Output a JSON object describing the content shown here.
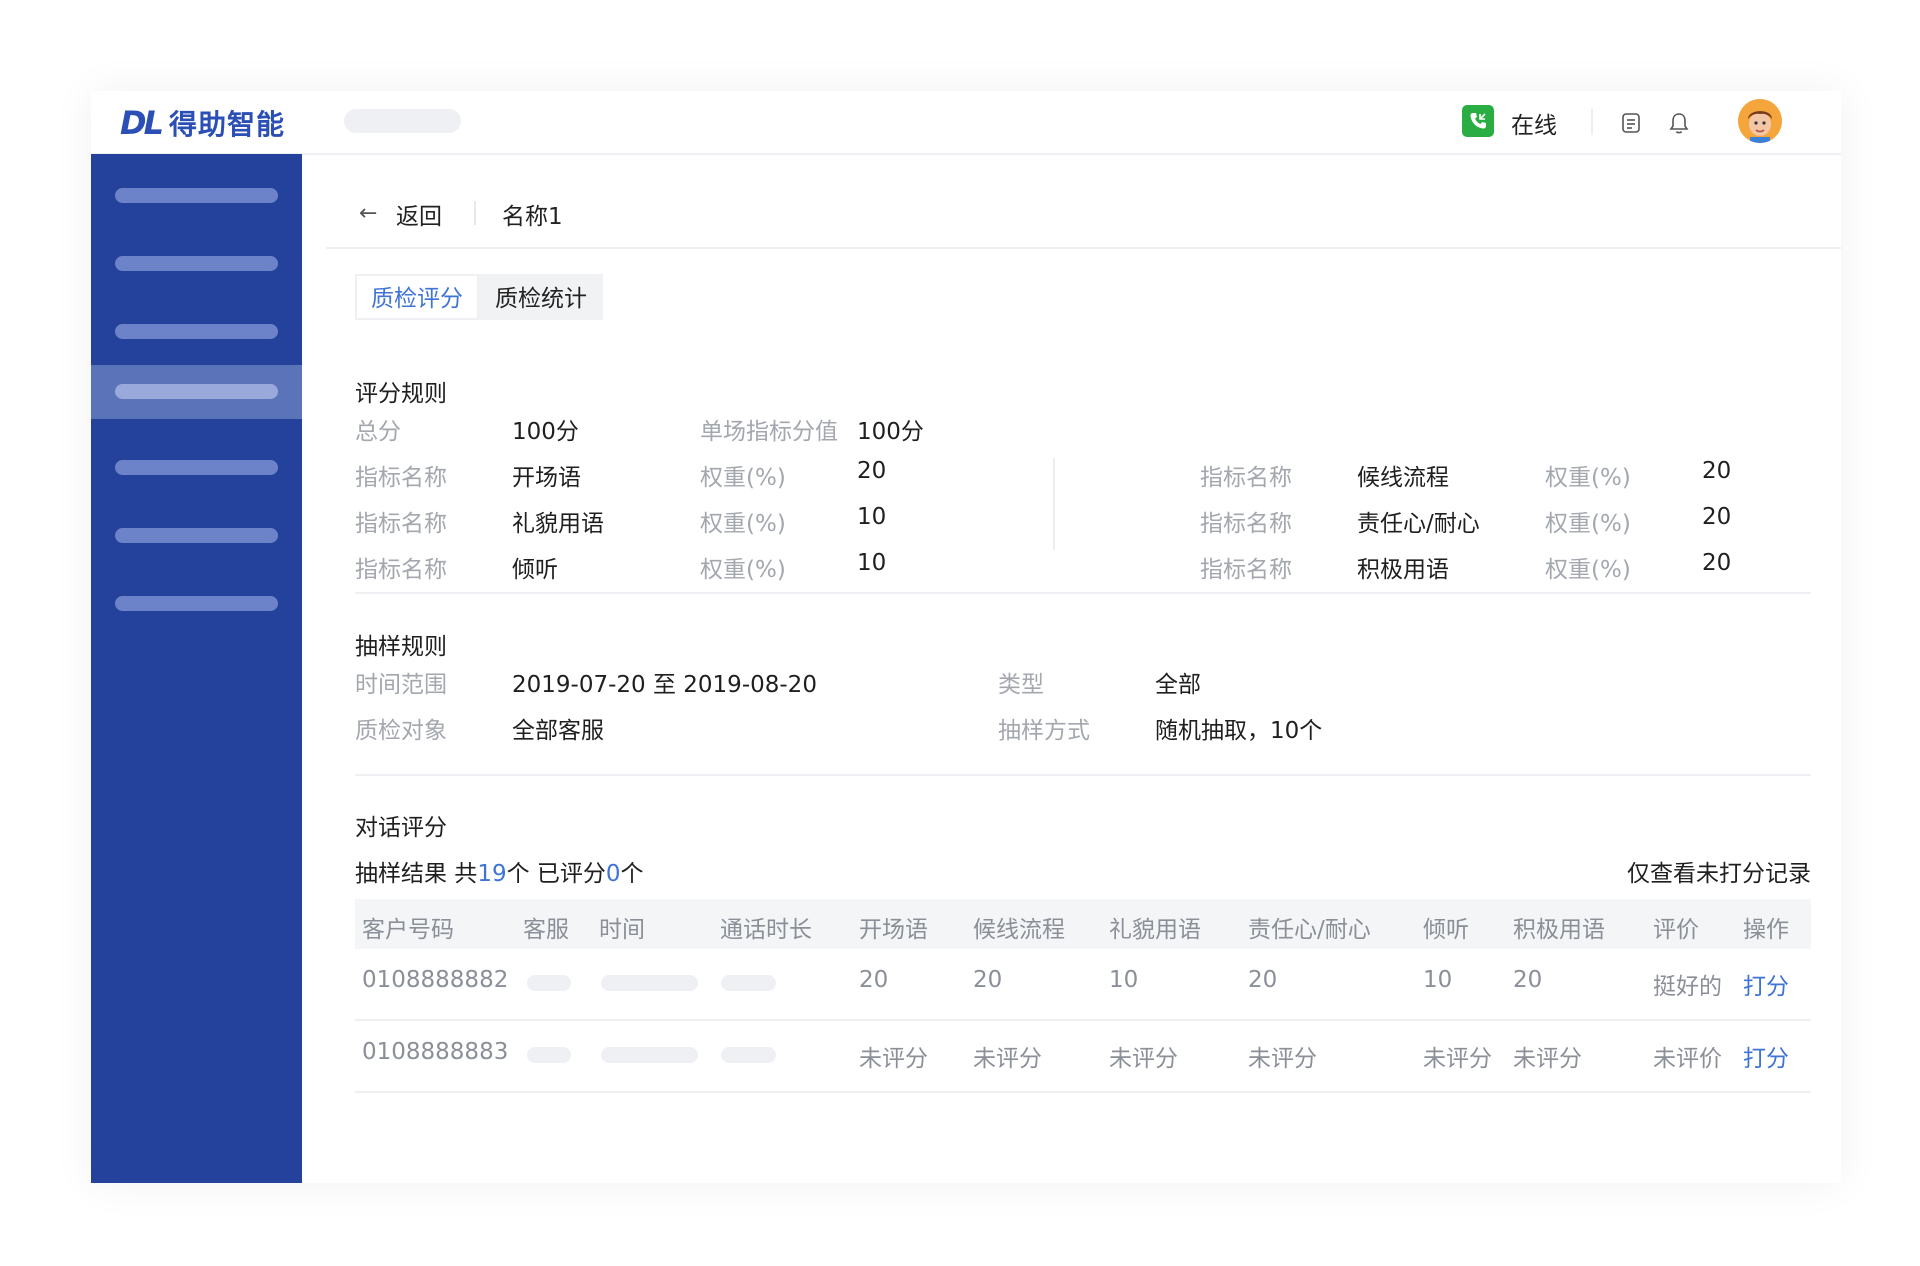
{
  "brand": {
    "mark": "DL",
    "name": "得助智能"
  },
  "header": {
    "status": "在线"
  },
  "breadcrumb": {
    "back": "返回",
    "title": "名称1",
    "back_arrow": "←"
  },
  "tabs": [
    {
      "label": "质检评分",
      "active": true
    },
    {
      "label": "质检统计",
      "active": false
    }
  ],
  "scoring": {
    "title": "评分规则",
    "total_label": "总分",
    "total_value": "100分",
    "single_label": "单场指标分值",
    "single_value": "100分",
    "left_rows": [
      {
        "name_label": "指标名称",
        "name": "开场语",
        "weight_label": "权重(%)",
        "weight": "20"
      },
      {
        "name_label": "指标名称",
        "name": "礼貌用语",
        "weight_label": "权重(%)",
        "weight": "10"
      },
      {
        "name_label": "指标名称",
        "name": "倾听",
        "weight_label": "权重(%)",
        "weight": "10"
      }
    ],
    "right_rows": [
      {
        "name_label": "指标名称",
        "name": "候线流程",
        "weight_label": "权重(%)",
        "weight": "20"
      },
      {
        "name_label": "指标名称",
        "name": "责任心/耐心",
        "weight_label": "权重(%)",
        "weight": "20"
      },
      {
        "name_label": "指标名称",
        "name": "积极用语",
        "weight_label": "权重(%)",
        "weight": "20"
      }
    ]
  },
  "sampling": {
    "title": "抽样规则",
    "range_label": "时间范围",
    "range_value": "2019-07-20 至 2019-08-20",
    "type_label": "类型",
    "type_value": "全部",
    "target_label": "质检对象",
    "target_value": "全部客服",
    "method_label": "抽样方式",
    "method_value": "随机抽取，10个"
  },
  "dialog": {
    "title": "对话评分",
    "summary_prefix": "抽样结果 共",
    "total": "19",
    "summary_mid": "个 已评分",
    "scored": "0",
    "summary_suffix": "个",
    "filter": "仅查看未打分记录"
  },
  "table": {
    "headers": [
      "客户号码",
      "客服",
      "时间",
      "通话时长",
      "开场语",
      "候线流程",
      "礼貌用语",
      "责任心/耐心",
      "倾听",
      "积极用语",
      "评价",
      "操作"
    ],
    "rows": [
      {
        "phone": "0108888882",
        "scores": [
          "20",
          "20",
          "10",
          "20",
          "10",
          "20"
        ],
        "comment": "挺好的",
        "action": "打分"
      },
      {
        "phone": "0108888883",
        "scores": [
          "未评分",
          "未评分",
          "未评分",
          "未评分",
          "未评分",
          "未评分"
        ],
        "comment": "未评价",
        "action": "打分"
      }
    ]
  },
  "icons": [
    "phone-icon",
    "document-icon",
    "bell-icon",
    "avatar",
    "back-arrow-icon"
  ],
  "colors": {
    "sidebar": "#24419c",
    "accent": "#3f74d6",
    "online": "#2aae43"
  }
}
